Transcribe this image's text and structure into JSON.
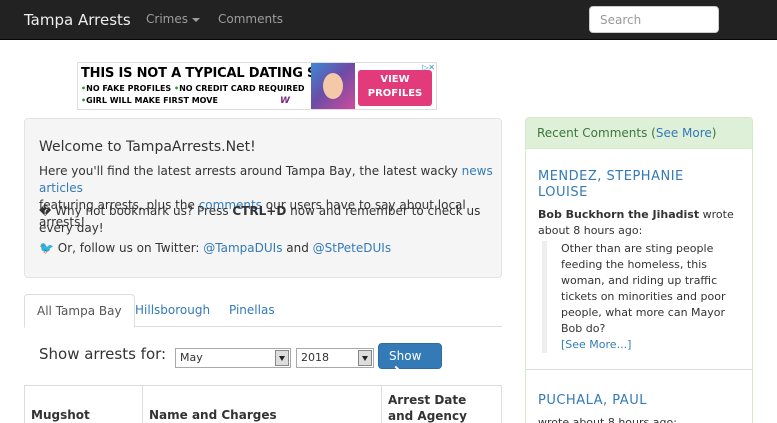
{
  "navbar": {
    "brand": "Tampa Arrests",
    "crimes": "Crimes",
    "comments": "Comments",
    "search_placeholder": "Search"
  },
  "ad": {
    "headline": "THIS IS NOT A TYPICAL DATING SITE",
    "line1": "NO FAKE PROFILES",
    "line1b": "NO CREDIT CARD REQUIRED",
    "line2": "GIRL WILL MAKE FIRST MOVE",
    "cta": "VIEW PROFILES",
    "logo": "W"
  },
  "welcome": {
    "title": "Welcome to TampaArrests.Net!",
    "p1_a": "Here you'll find the latest arrests around Tampa Bay, the latest wacky ",
    "p1_link1": "news articles",
    "p1_b": "featuring arrests, plus the ",
    "p1_link2": "comments",
    "p1_c": " our users have to say about local arrests!",
    "p2_a": "� Why not bookmark us? Press ",
    "p2_kbd": "CTRL+D",
    "p2_b": " now and remember to check us every day!",
    "p3_a": " Or, follow us on Twitter: ",
    "p3_link1": "@TampaDUIs",
    "p3_and": " and ",
    "p3_link2": "@StPeteDUIs"
  },
  "tabs": [
    {
      "label": "All Tampa Bay"
    },
    {
      "label": "Hillsborough"
    },
    {
      "label": "Pinellas"
    }
  ],
  "filter": {
    "label": "Show arrests for:",
    "month": "May",
    "year": "2018",
    "button": "Show"
  },
  "table": {
    "headers": [
      "Mugshot",
      "Name and Charges",
      "Arrest Date and Agency"
    ]
  },
  "sidebar": {
    "heading": "Recent Comments (",
    "see_more": "See More",
    "heading_end": ")",
    "comment1": {
      "name": "MENDEZ, STEPHANIE LOUISE",
      "author": "Bob Buckhorn the Jihadist",
      "meta": " wrote about 8 hours ago:",
      "text": "Other than are sting people feeding the homeless, this woman, and riding up traffic tickets on minorities and poor people, what more can Mayor Bob do?",
      "more": "[See More...]"
    },
    "comment2": {
      "name": "PUCHALA, PAUL",
      "meta": "wrote about 8 hours ago:"
    }
  }
}
